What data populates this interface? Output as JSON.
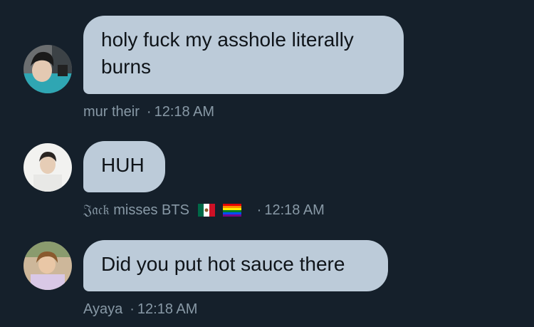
{
  "messages": [
    {
      "text_line1": "holy fuck my asshole literally",
      "text_line2": "burns",
      "sender": "mur their",
      "separator": "·",
      "time": "12:18 AM"
    },
    {
      "text": "HUH",
      "sender": "𝔍𝔞𝔠𝔨 misses BTS",
      "separator": "·",
      "time": "12:18 AM",
      "flags": [
        "mexico-flag-icon",
        "rainbow-flag-icon"
      ]
    },
    {
      "text": "Did you put hot sauce there",
      "sender": "Ayaya",
      "separator": "·",
      "time": "12:18 AM"
    }
  ],
  "colors": {
    "background": "#15202b",
    "bubble": "#bccbd9",
    "meta_text": "#8899a6"
  }
}
